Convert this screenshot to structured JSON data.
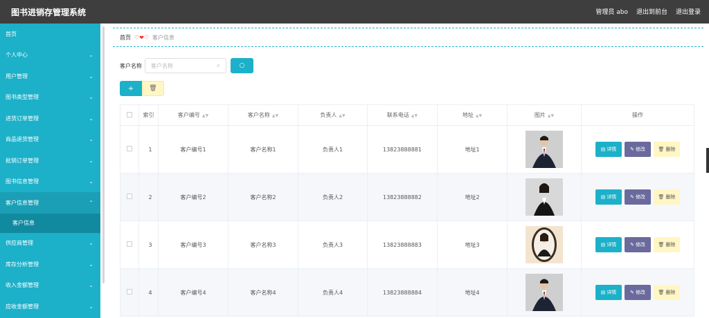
{
  "header": {
    "title": "图书进销存管理系统",
    "user": "管理员 abo",
    "links": [
      "退出到前台",
      "退出登录"
    ]
  },
  "sidebar": {
    "items": [
      {
        "label": "首页",
        "chevron": ""
      },
      {
        "label": "个人中心",
        "chevron": "⌄"
      },
      {
        "label": "用户管理",
        "chevron": "⌄"
      },
      {
        "label": "图书类型管理",
        "chevron": "⌄"
      },
      {
        "label": "进货订单管理",
        "chevron": "⌄"
      },
      {
        "label": "商品退货管理",
        "chevron": "⌄"
      },
      {
        "label": "批销订单管理",
        "chevron": "⌄"
      },
      {
        "label": "图书信息管理",
        "chevron": "⌄"
      },
      {
        "label": "客户信息管理",
        "chevron": "⌃"
      }
    ],
    "sub_item": "客户信息",
    "items_after": [
      {
        "label": "供应商管理",
        "chevron": "⌄"
      },
      {
        "label": "库存分析管理",
        "chevron": "⌄"
      },
      {
        "label": "收入金额管理",
        "chevron": "⌄"
      },
      {
        "label": "应收金额管理",
        "chevron": "⌄"
      }
    ]
  },
  "breadcrumb": {
    "home": "首页",
    "current": "客户信息"
  },
  "search": {
    "label": "客户名称",
    "placeholder": "客户名称",
    "value": ""
  },
  "table": {
    "headers": [
      "索引",
      "客户编号",
      "客户名称",
      "负责人",
      "联系电话",
      "地址",
      "图片",
      "操作"
    ],
    "rows": [
      {
        "index": "1",
        "code": "客户编号1",
        "name": "客户名称1",
        "owner": "负责人1",
        "phone": "13823888881",
        "address": "地址1",
        "photo": "man-suit"
      },
      {
        "index": "2",
        "code": "客户编号2",
        "name": "客户名称2",
        "owner": "负责人2",
        "phone": "13823888882",
        "address": "地址2",
        "photo": "woman-suit"
      },
      {
        "index": "3",
        "code": "客户编号3",
        "name": "客户名称3",
        "owner": "负责人3",
        "phone": "13823888883",
        "address": "地址3",
        "photo": "woman-oval"
      },
      {
        "index": "4",
        "code": "客户编号4",
        "name": "客户名称4",
        "owner": "负责人4",
        "phone": "13823888884",
        "address": "地址4",
        "photo": "man-suit"
      }
    ],
    "ops": {
      "detail": "详情",
      "edit": "修改",
      "delete": "删除"
    }
  },
  "colors": {
    "accent": "#1cb0c9",
    "topbar": "#3e3e3e",
    "edit": "#6a6a9d",
    "delete": "#fff6c4"
  }
}
